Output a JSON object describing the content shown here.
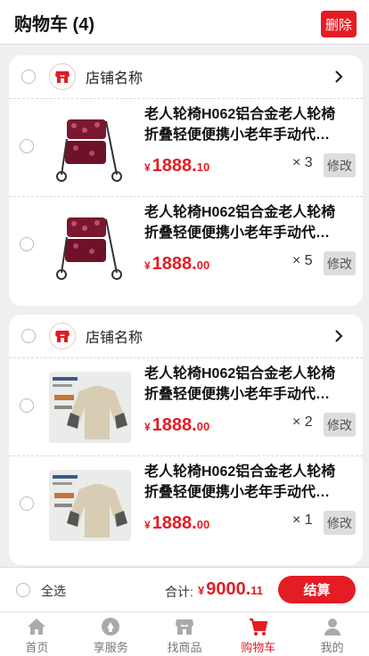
{
  "header": {
    "title": "购物车 (4)",
    "delete_label": "删除"
  },
  "shops": [
    {
      "name": "店铺名称",
      "items": [
        {
          "title": "老人轮椅H062铝合金老人轮椅折叠轻便便携小老年手动代…",
          "currency": "¥",
          "price_int": "1888.",
          "price_dec": "10",
          "qty": "× 3",
          "edit_label": "修改",
          "image": "walker"
        },
        {
          "title": "老人轮椅H062铝合金老人轮椅折叠轻便便携小老年手动代…",
          "currency": "¥",
          "price_int": "1888.",
          "price_dec": "00",
          "qty": "× 5",
          "edit_label": "修改",
          "image": "walker"
        }
      ]
    },
    {
      "name": "店铺名称",
      "items": [
        {
          "title": "老人轮椅H062铝合金老人轮椅折叠轻便便携小老年手动代…",
          "currency": "¥",
          "price_int": "1888.",
          "price_dec": "00",
          "qty": "× 2",
          "edit_label": "修改",
          "image": "sweater"
        },
        {
          "title": "老人轮椅H062铝合金老人轮椅折叠轻便便携小老年手动代…",
          "currency": "¥",
          "price_int": "1888.",
          "price_dec": "00",
          "qty": "× 1",
          "edit_label": "修改",
          "image": "sweater"
        }
      ]
    }
  ],
  "footer": {
    "select_all": "全选",
    "total_label": "合计:",
    "currency": "¥",
    "total_int": "9000.",
    "total_dec": "11",
    "checkout_label": "结算"
  },
  "tabs": [
    {
      "label": "首页",
      "icon": "home-icon",
      "active": false
    },
    {
      "label": "享服务",
      "icon": "service-icon",
      "active": false
    },
    {
      "label": "找商品",
      "icon": "store-icon",
      "active": false
    },
    {
      "label": "购物车",
      "icon": "cart-icon",
      "active": true
    },
    {
      "label": "我的",
      "icon": "user-icon",
      "active": false
    }
  ],
  "colors": {
    "accent": "#e41c24",
    "background": "#efefef"
  }
}
